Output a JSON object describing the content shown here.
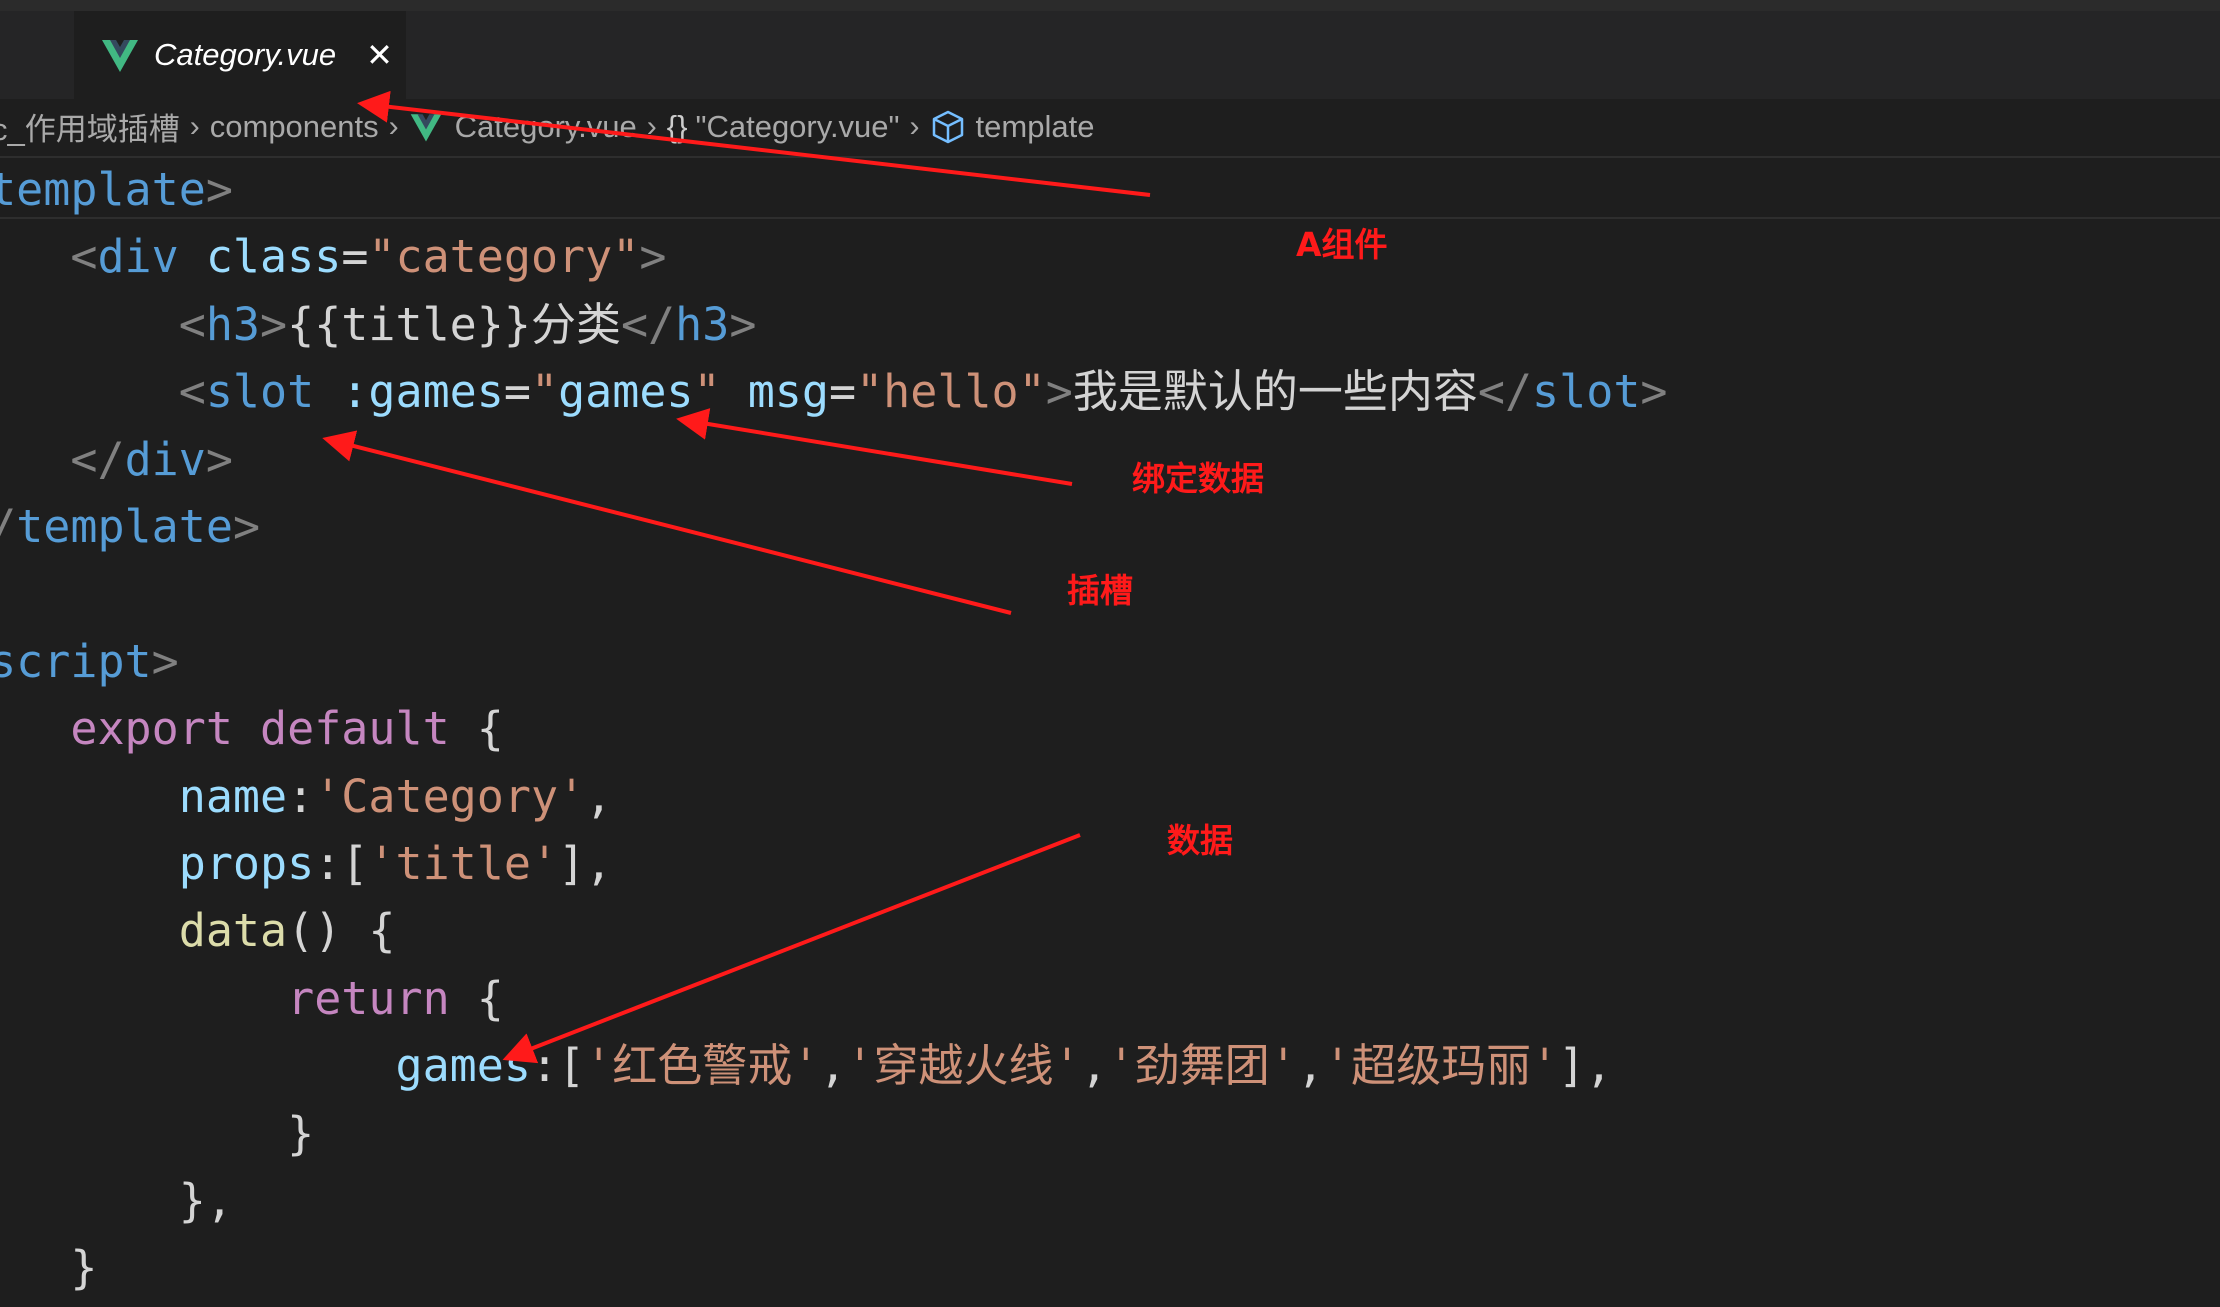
{
  "tab": {
    "label": "Category.vue",
    "icon": "vue-icon",
    "close": "✕"
  },
  "breadcrumb": {
    "items": [
      "c_作用域插槽",
      "components",
      "Category.vue",
      "\"Category.vue\"",
      "template"
    ],
    "separator": "›",
    "braces": "{}"
  },
  "code_lines": [
    [
      [
        "br",
        "<"
      ],
      [
        "tag",
        "template"
      ],
      [
        "br",
        ">"
      ]
    ],
    [
      [
        "txt",
        "    "
      ],
      [
        "br",
        "<"
      ],
      [
        "tag",
        "div"
      ],
      [
        "txt",
        " "
      ],
      [
        "attr",
        "class"
      ],
      [
        "txt",
        "="
      ],
      [
        "str",
        "\"category\""
      ],
      [
        "br",
        ">"
      ]
    ],
    [
      [
        "txt",
        "        "
      ],
      [
        "br",
        "<"
      ],
      [
        "tag",
        "h3"
      ],
      [
        "br",
        ">"
      ],
      [
        "txt",
        "{{title}}分类"
      ],
      [
        "br",
        "</"
      ],
      [
        "tag",
        "h3"
      ],
      [
        "br",
        ">"
      ]
    ],
    [
      [
        "txt",
        "        "
      ],
      [
        "br",
        "<"
      ],
      [
        "tag",
        "slot"
      ],
      [
        "txt",
        " "
      ],
      [
        "attr",
        ":games"
      ],
      [
        "txt",
        "="
      ],
      [
        "str",
        "\""
      ],
      [
        "attr",
        "games"
      ],
      [
        "str",
        "\""
      ],
      [
        "txt",
        " "
      ],
      [
        "attr",
        "msg"
      ],
      [
        "txt",
        "="
      ],
      [
        "str",
        "\"hello\""
      ],
      [
        "br",
        ">"
      ],
      [
        "txt",
        "我是默认的一些内容"
      ],
      [
        "br",
        "</"
      ],
      [
        "tag",
        "slot"
      ],
      [
        "br",
        ">"
      ]
    ],
    [
      [
        "txt",
        "    "
      ],
      [
        "br",
        "</"
      ],
      [
        "tag",
        "div"
      ],
      [
        "br",
        ">"
      ]
    ],
    [
      [
        "br",
        "</"
      ],
      [
        "tag",
        "template"
      ],
      [
        "br",
        ">"
      ]
    ],
    [],
    [
      [
        "br",
        "<"
      ],
      [
        "tag",
        "script"
      ],
      [
        "br",
        ">"
      ]
    ],
    [
      [
        "txt",
        "    "
      ],
      [
        "kw",
        "export"
      ],
      [
        "txt",
        " "
      ],
      [
        "kw",
        "default"
      ],
      [
        "txt",
        " {"
      ]
    ],
    [
      [
        "txt",
        "        "
      ],
      [
        "attr",
        "name"
      ],
      [
        "txt",
        ":"
      ],
      [
        "str",
        "'Category'"
      ],
      [
        "txt",
        ","
      ]
    ],
    [
      [
        "txt",
        "        "
      ],
      [
        "attr",
        "props"
      ],
      [
        "txt",
        ":["
      ],
      [
        "str",
        "'title'"
      ],
      [
        "txt",
        "],"
      ]
    ],
    [
      [
        "txt",
        "        "
      ],
      [
        "fn",
        "data"
      ],
      [
        "txt",
        "() {"
      ]
    ],
    [
      [
        "txt",
        "            "
      ],
      [
        "kw",
        "return"
      ],
      [
        "txt",
        " {"
      ]
    ],
    [
      [
        "txt",
        "                "
      ],
      [
        "attr",
        "games"
      ],
      [
        "txt",
        ":["
      ],
      [
        "str",
        "'红色警戒'"
      ],
      [
        "txt",
        ","
      ],
      [
        "str",
        "'穿越火线'"
      ],
      [
        "txt",
        ","
      ],
      [
        "str",
        "'劲舞团'"
      ],
      [
        "txt",
        ","
      ],
      [
        "str",
        "'超级玛丽'"
      ],
      [
        "txt",
        "],"
      ]
    ],
    [
      [
        "txt",
        "            }"
      ]
    ],
    [
      [
        "txt",
        "        },"
      ]
    ],
    [
      [
        "txt",
        "    }"
      ]
    ]
  ],
  "annotations": {
    "a_component": "A组件",
    "bind_data": "绑定数据",
    "slot": "插槽",
    "data": "数据",
    "color": "#ff1a1a"
  }
}
